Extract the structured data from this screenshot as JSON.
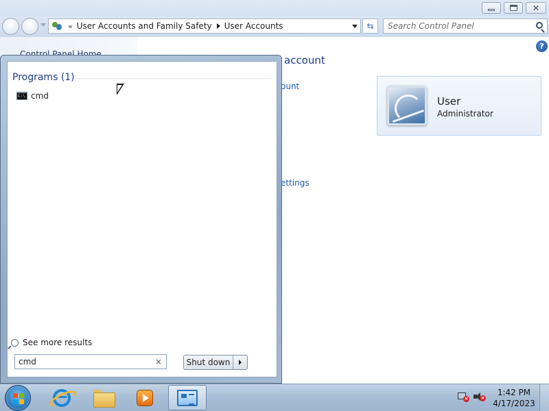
{
  "window": {
    "address": {
      "overflow": "«",
      "segments": [
        "User Accounts and Family Safety",
        "User Accounts"
      ]
    },
    "search_placeholder": "Search Control Panel",
    "nav": {
      "control_panel_home": "Control Panel Home"
    },
    "content": {
      "heading_fragment": "account",
      "link_fragment_1": "ount",
      "link_fragment_2": "ettings",
      "user_tile": {
        "name": "User",
        "role": "Administrator"
      }
    }
  },
  "start_menu": {
    "programs_header": "Programs (1)",
    "programs": [
      {
        "label": "cmd",
        "icon": "cmd-icon"
      }
    ],
    "see_more_label": "See more results",
    "search_value": "cmd",
    "clear_glyph": "×",
    "shutdown_label": "Shut down"
  },
  "taskbar": {
    "pinned": [
      "internet-explorer-icon",
      "windows-explorer-icon",
      "media-player-icon",
      "control-panel-icon"
    ],
    "clock": {
      "time": "1:42 PM",
      "date": "4/17/2023"
    }
  },
  "colors": {
    "link": "#1a5ba6",
    "heading": "#1e3d84",
    "taskbar": "#a9bfd6"
  }
}
